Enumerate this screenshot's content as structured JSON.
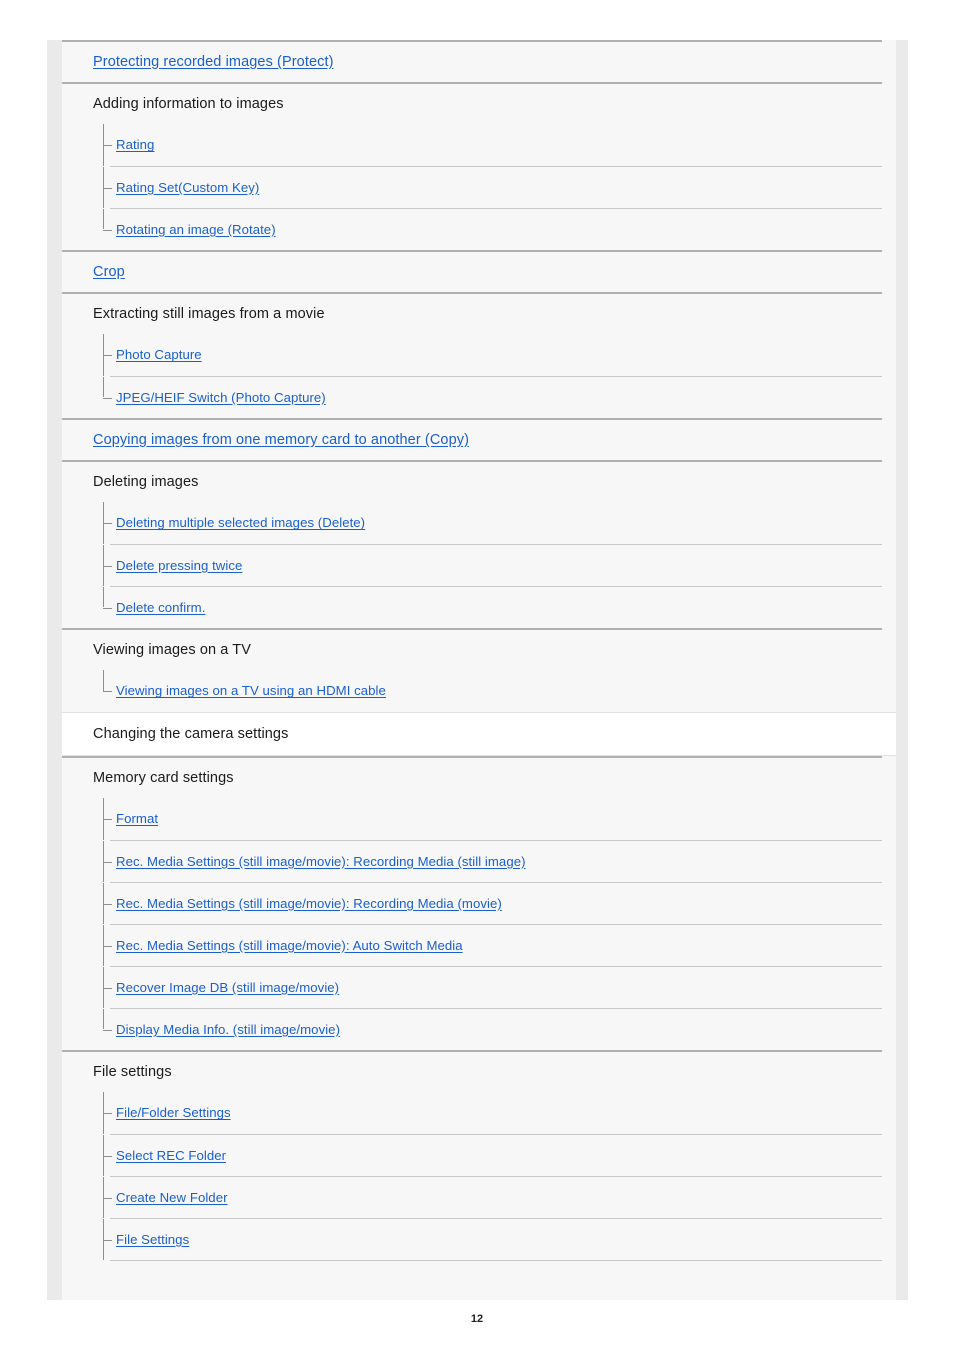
{
  "page": {
    "number": "12"
  },
  "toc": {
    "blocks": [
      {
        "kind": "link",
        "label": "Protecting recorded images (Protect)"
      },
      {
        "kind": "group",
        "label": "Adding information to images",
        "children": [
          "Rating",
          "Rating Set(Custom Key)",
          "Rotating an image (Rotate)"
        ]
      },
      {
        "kind": "link",
        "label": "Crop"
      },
      {
        "kind": "group",
        "label": "Extracting still images from a movie",
        "children": [
          "Photo Capture",
          "JPEG/HEIF Switch (Photo Capture)"
        ]
      },
      {
        "kind": "link",
        "label": "Copying images from one memory card to another (Copy)"
      },
      {
        "kind": "group",
        "label": "Deleting images",
        "children": [
          "Deleting multiple selected images (Delete)",
          "Delete pressing twice",
          "Delete confirm."
        ]
      },
      {
        "kind": "group",
        "label": "Viewing images on a TV",
        "children": [
          "Viewing images on a TV using an HDMI cable"
        ]
      },
      {
        "kind": "section",
        "label": "Changing the camera settings"
      },
      {
        "kind": "group",
        "label": "Memory card settings",
        "children": [
          "Format",
          "Rec. Media Settings (still image/movie): Recording Media (still image)",
          "Rec. Media Settings (still image/movie): Recording Media (movie)",
          "Rec. Media Settings (still image/movie): Auto Switch Media",
          "Recover Image DB (still image/movie)",
          "Display Media Info. (still image/movie)"
        ]
      },
      {
        "kind": "group",
        "label": "File settings",
        "children": [
          "File/Folder Settings",
          "Select REC Folder",
          "Create New Folder",
          "File Settings"
        ],
        "clipped": true
      }
    ]
  },
  "colors": {
    "link": "#1a5fd0",
    "text": "#1a1a1a",
    "card_background": "#f7f7f7",
    "gutter": "#eaeaea",
    "section_band": "#ffffff",
    "rule_major": "#b0b0b0",
    "rule_minor": "#c9c9c9",
    "tree_guide": "#8e8e8e"
  }
}
